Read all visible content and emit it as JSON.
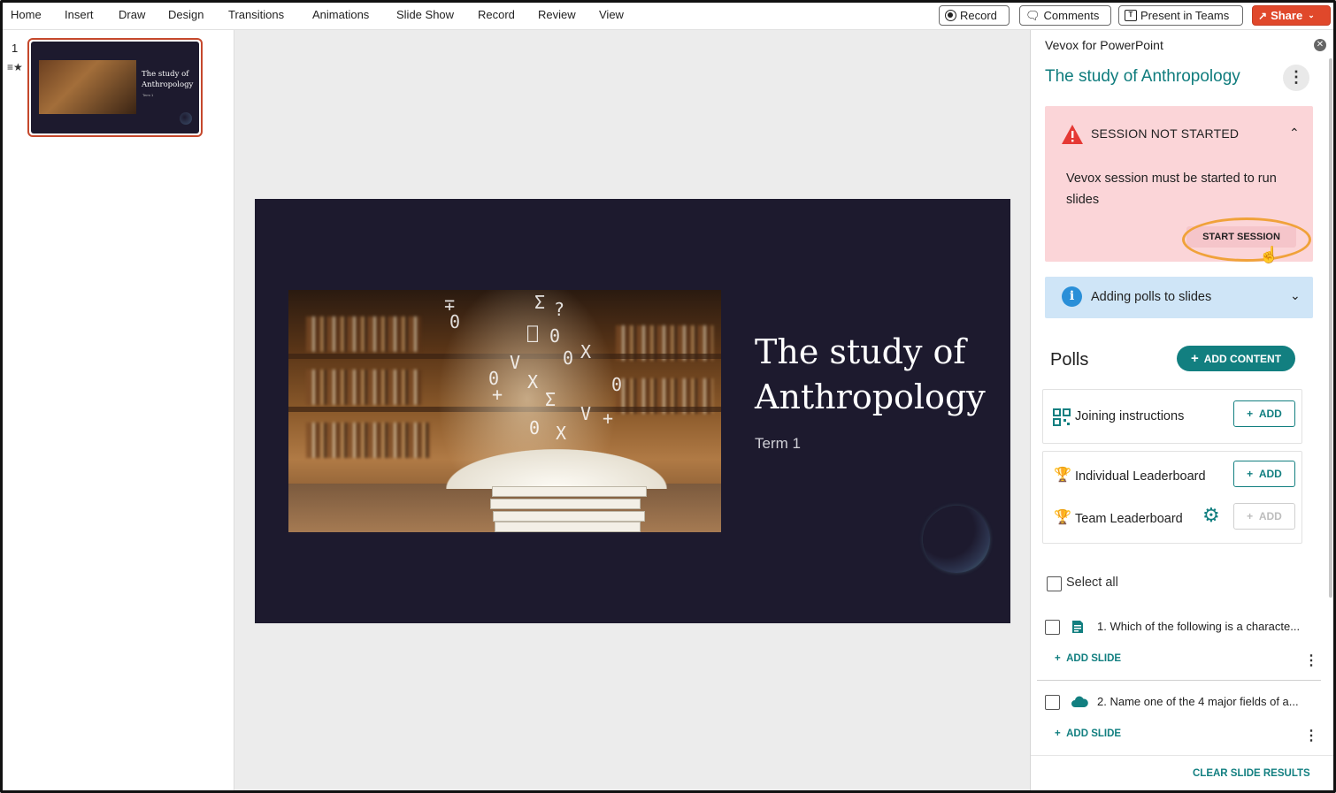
{
  "menu": [
    "Home",
    "Insert",
    "Draw",
    "Design",
    "Transitions",
    "Animations",
    "Slide Show",
    "Record",
    "Review",
    "View"
  ],
  "ribbon_buttons": {
    "record": "Record",
    "comments": "Comments",
    "present_teams": "Present in Teams",
    "share": "Share"
  },
  "thumbnails": {
    "slide_number": "1",
    "title_line1": "The study of",
    "title_line2": "Anthropology",
    "subtitle": "Term 1"
  },
  "slide": {
    "title_line1": "The study of",
    "title_line2": "Anthropology",
    "subtitle": "Term 1"
  },
  "pane": {
    "title": "Vevox for PowerPoint",
    "presentation_title": "The study of Anthropology",
    "alert": {
      "heading": "SESSION NOT STARTED",
      "message": "Vevox session must be started to run slides",
      "button": "START SESSION"
    },
    "info": {
      "label": "Adding polls to slides"
    },
    "polls_heading": "Polls",
    "add_content": "ADD CONTENT",
    "cards": {
      "joining": "Joining instructions",
      "individual": "Individual Leaderboard",
      "team": "Team Leaderboard",
      "add": "ADD"
    },
    "select_all": "Select all",
    "questions": [
      {
        "text": "1. Which of the following is a characte...",
        "add_slide": "ADD SLIDE"
      },
      {
        "text": "2. Name one of the 4 major fields of a...",
        "add_slide": "ADD SLIDE"
      }
    ],
    "clear": "CLEAR SLIDE RESULTS"
  },
  "colors": {
    "accent": "#127f80",
    "share": "#e0482b",
    "alert_bg": "#fbd5d8",
    "info_bg": "#cfe5f7",
    "slide_bg": "#1d1a2e"
  }
}
